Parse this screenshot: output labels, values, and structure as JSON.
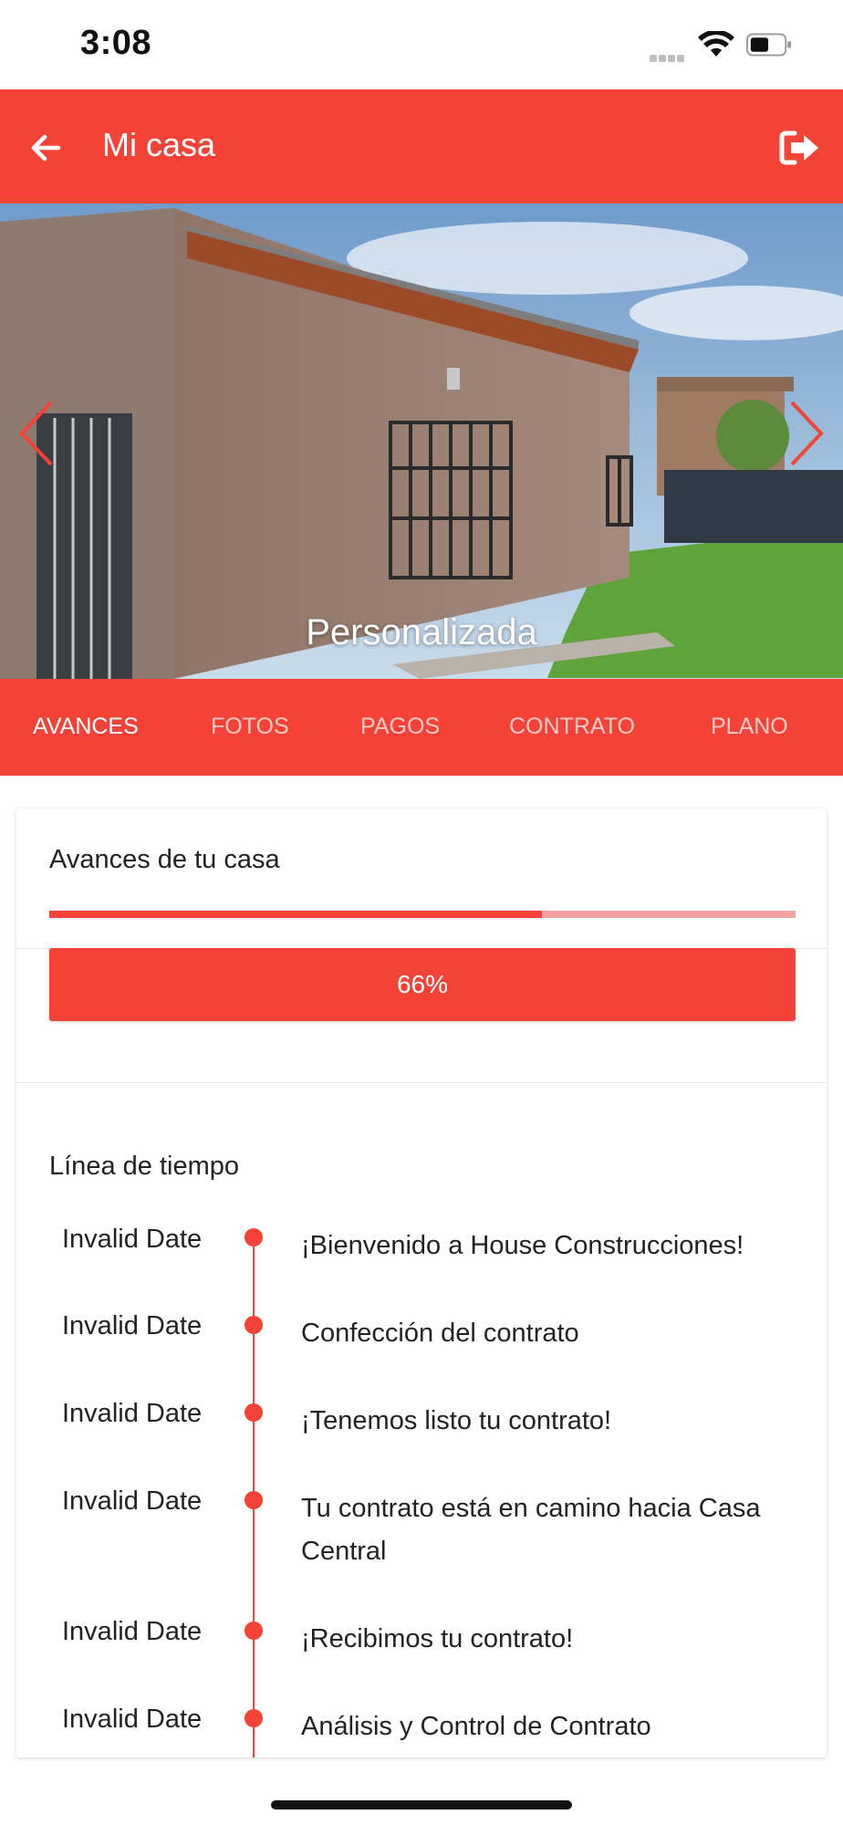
{
  "status_bar": {
    "time": "3:08"
  },
  "app_bar": {
    "title": "Mi casa"
  },
  "hero": {
    "caption": "Personalizada"
  },
  "tabs": [
    {
      "label": "AVANCES",
      "active": true
    },
    {
      "label": "FOTOS",
      "active": false
    },
    {
      "label": "PAGOS",
      "active": false
    },
    {
      "label": "CONTRATO",
      "active": false
    },
    {
      "label": "PLANO",
      "active": false
    }
  ],
  "progress": {
    "title": "Avances de tu casa",
    "percent": 0.66,
    "percent_label": "66%"
  },
  "timeline": {
    "title": "Línea de tiempo",
    "items": [
      {
        "date": "Invalid Date",
        "text": "¡Bienvenido a House Construcciones!"
      },
      {
        "date": "Invalid Date",
        "text": "Confección del contrato"
      },
      {
        "date": "Invalid Date",
        "text": "¡Tenemos listo tu contrato!"
      },
      {
        "date": "Invalid Date",
        "text": "Tu contrato está en camino hacia Casa Central"
      },
      {
        "date": "Invalid Date",
        "text": "¡Recibimos tu contrato!"
      },
      {
        "date": "Invalid Date",
        "text": "Análisis y Control de Contrato"
      }
    ]
  },
  "colors": {
    "accent": "#f44336",
    "accent_light": "#f5a3a0"
  },
  "icons": [
    "arrow-left-icon",
    "logout-icon",
    "chevron-left-icon",
    "chevron-right-icon",
    "wifi-icon",
    "battery-icon",
    "signal-icon"
  ]
}
